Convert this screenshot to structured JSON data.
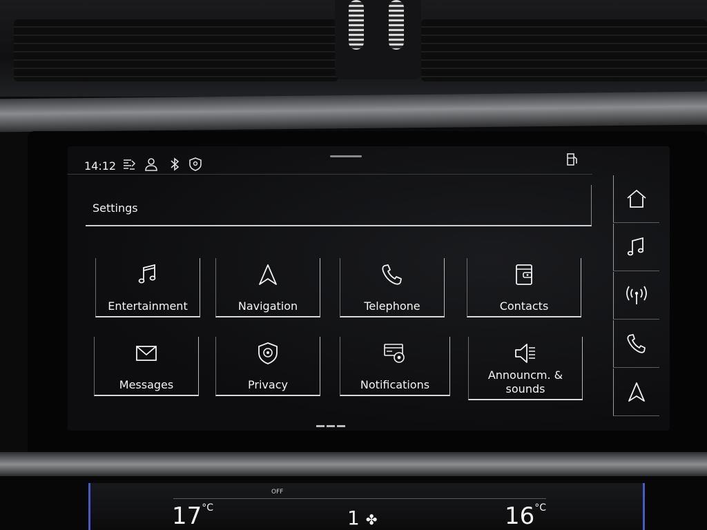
{
  "statusbar": {
    "time": "14:12"
  },
  "header": {
    "title": "Settings"
  },
  "tiles": [
    {
      "label": "Entertainment",
      "icon": "music-note-icon"
    },
    {
      "label": "Navigation",
      "icon": "navigation-arrow-icon"
    },
    {
      "label": "Telephone",
      "icon": "phone-icon"
    },
    {
      "label": "Contacts",
      "icon": "contacts-book-icon"
    },
    {
      "label": "Messages",
      "icon": "envelope-icon"
    },
    {
      "label": "Privacy",
      "icon": "privacy-shield-icon"
    },
    {
      "label": "Notifications",
      "icon": "notifications-gear-icon"
    },
    {
      "label": "Announcm. & sounds",
      "icon": "speaker-icon"
    }
  ],
  "shortcuts": [
    {
      "name": "home",
      "icon": "home-icon"
    },
    {
      "name": "media",
      "icon": "music-note-icon"
    },
    {
      "name": "radio",
      "icon": "radio-signal-icon"
    },
    {
      "name": "phone",
      "icon": "phone-icon"
    },
    {
      "name": "navigation",
      "icon": "navigation-arrow-icon"
    }
  ],
  "climate": {
    "left_temp": "17",
    "right_temp": "16",
    "unit": "°C",
    "fan_level": "1",
    "off_label": "OFF"
  },
  "colors": {
    "accent": "#4a58c9",
    "tile_border": "#d9d9d9",
    "text": "#f4f4f4"
  }
}
